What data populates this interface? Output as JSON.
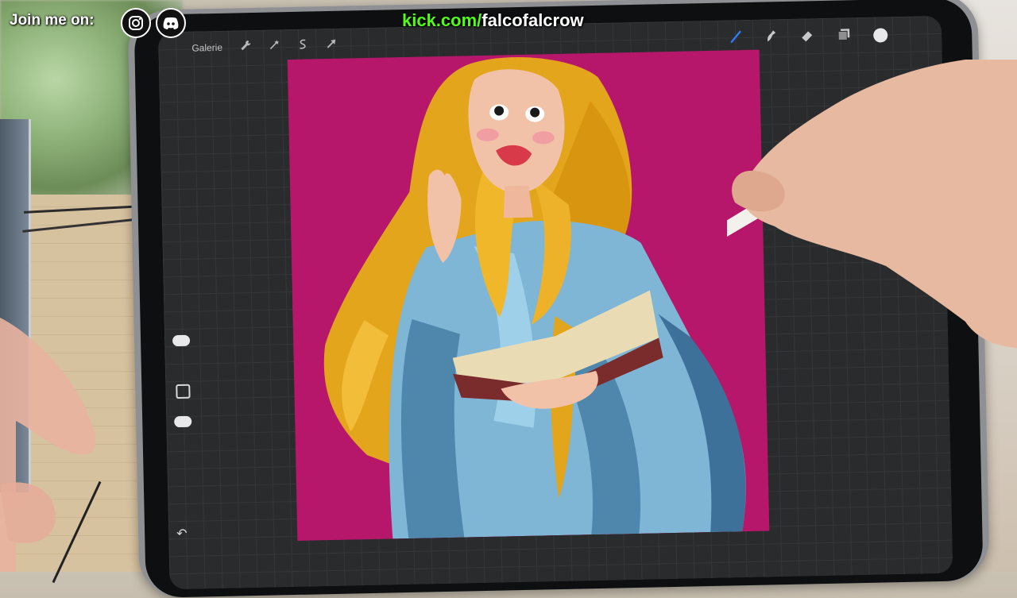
{
  "overlay": {
    "join_label": "Join me on:",
    "social_icons": [
      "instagram-icon",
      "discord-icon"
    ],
    "kick_domain": "kick.com/",
    "kick_user": "falcofalcrow",
    "kick_color": "#53fc18"
  },
  "procreate": {
    "gallery_label": "Galerie",
    "left_tools": [
      "wrench-icon",
      "magic-wand-icon",
      "selection-icon",
      "transform-arrow-icon"
    ],
    "right_tools": [
      "brush-icon",
      "smudge-icon",
      "eraser-icon",
      "layers-icon",
      "color-icon"
    ],
    "active_tool": "brush-icon",
    "active_color": "#e8e8ea",
    "accent": "#2f7bf5",
    "sidebar": [
      "brush-size-slider",
      "modify-button",
      "opacity-slider",
      "undo-icon"
    ]
  },
  "canvas": {
    "background_color": "#b7176b"
  }
}
